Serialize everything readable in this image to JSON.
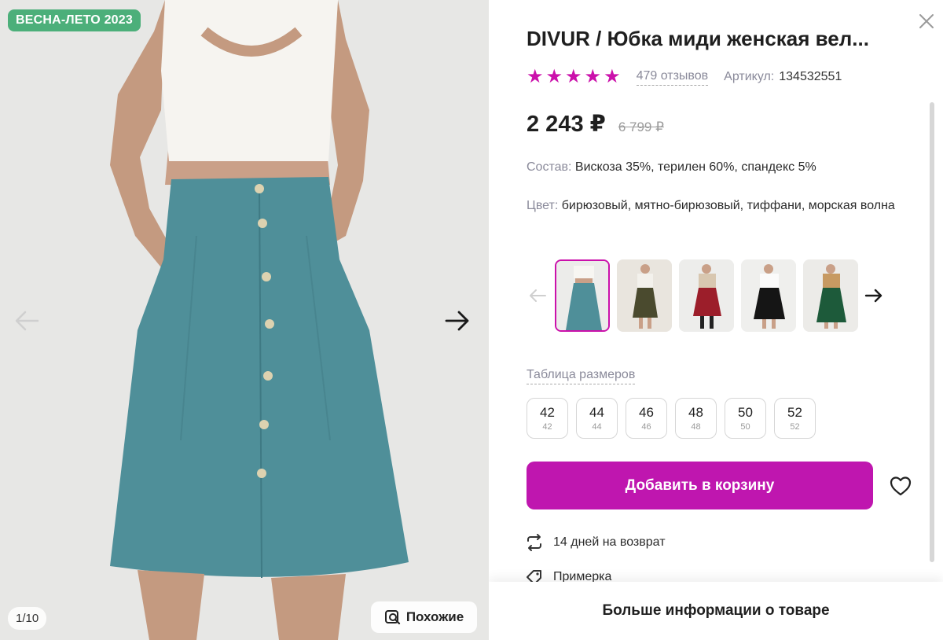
{
  "gallery": {
    "badge": "ВЕСНА-ЛЕТО 2023",
    "counter": "1/10",
    "similar_label": "Похожие",
    "icons": {
      "prev": "arrow-left-icon",
      "next": "arrow-right-icon",
      "similar": "search-image-icon"
    }
  },
  "product": {
    "title": "DIVUR / Юбка миди женская вел...",
    "rating_stars": 5,
    "reviews": "479 отзывов",
    "article_label": "Артикул:",
    "article_value": "134532551",
    "price": "2 243 ₽",
    "old_price": "6 799 ₽",
    "composition_label": "Состав:",
    "composition_value": "Вискоза 35%, терилен 60%, спандекс 5%",
    "color_label": "Цвет:",
    "color_value": "бирюзовый, мятно-бирюзовый, тиффани, морская волна"
  },
  "variants": {
    "items": [
      {
        "name": "teal"
      },
      {
        "name": "olive"
      },
      {
        "name": "red"
      },
      {
        "name": "black"
      },
      {
        "name": "green"
      }
    ],
    "selected_index": 0
  },
  "sizes": {
    "table_link": "Таблица размеров",
    "items": [
      {
        "main": "42",
        "sub": "42"
      },
      {
        "main": "44",
        "sub": "44"
      },
      {
        "main": "46",
        "sub": "46"
      },
      {
        "main": "48",
        "sub": "48"
      },
      {
        "main": "50",
        "sub": "50"
      },
      {
        "main": "52",
        "sub": "52"
      }
    ]
  },
  "actions": {
    "add_to_cart": "Добавить в корзину",
    "favorite_icon": "heart-icon"
  },
  "info": {
    "returns": "14 дней на возврат",
    "fitting": "Примерка",
    "more_info": "Больше информации о товаре"
  },
  "colors": {
    "accent": "#cb11ab",
    "cart_button": "#bf16af",
    "badge": "#4caf7a",
    "skirt": "#4f8f99"
  }
}
